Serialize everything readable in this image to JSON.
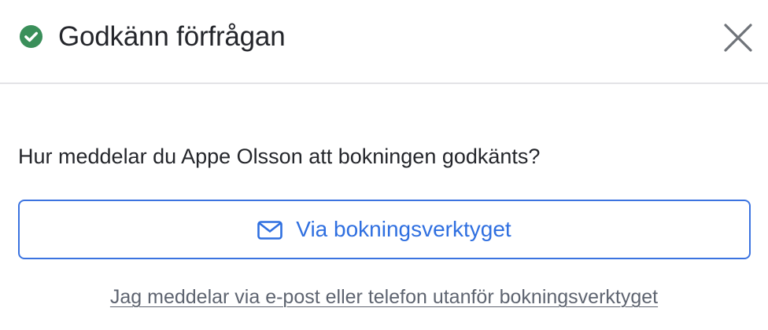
{
  "dialog": {
    "title": "Godkänn förfrågan",
    "close_icon": "close-icon",
    "status_icon": "check-circle-icon"
  },
  "body": {
    "question": "Hur meddelar du Appe Olsson att bokningen godkänts?",
    "primary_button": {
      "label": "Via bokningsverktyget",
      "icon": "mail-icon"
    },
    "alternative_link": "Jag meddelar via e-post eller telefon utanför bokningsverktyget"
  },
  "colors": {
    "success": "#3a8f5a",
    "accent": "#2f6fe0",
    "border": "#3b73e0",
    "muted_text": "#5e6470",
    "divider": "#e3e3e6"
  }
}
